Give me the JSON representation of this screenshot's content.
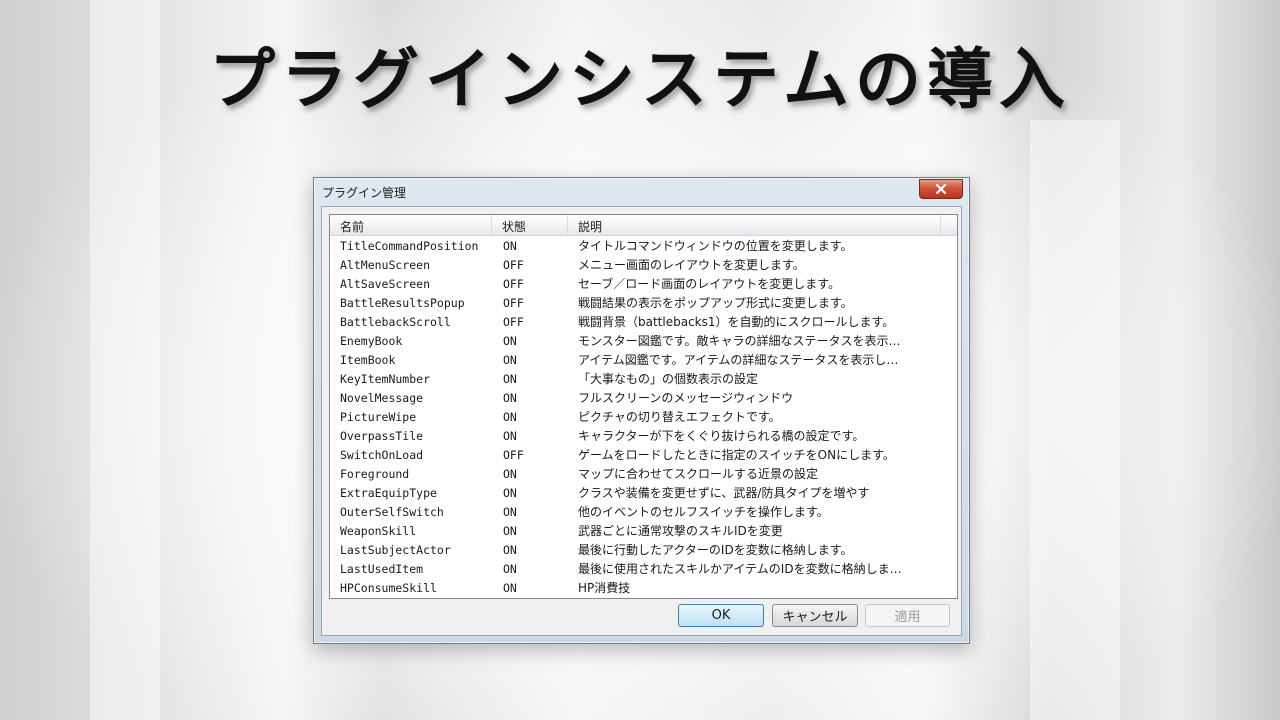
{
  "headline": "プラグインシステムの導入",
  "window": {
    "title": "プラグイン管理",
    "close_icon": "close-x-icon"
  },
  "list": {
    "columns": [
      "名前",
      "状態",
      "説明"
    ],
    "rows": [
      {
        "name": "TitleCommandPosition",
        "status": "ON",
        "desc": "タイトルコマンドウィンドウの位置を変更します。"
      },
      {
        "name": "AltMenuScreen",
        "status": "OFF",
        "desc": "メニュー画面のレイアウトを変更します。"
      },
      {
        "name": "AltSaveScreen",
        "status": "OFF",
        "desc": "セーブ／ロード画面のレイアウトを変更します。"
      },
      {
        "name": "BattleResultsPopup",
        "status": "OFF",
        "desc": "戦闘結果の表示をポップアップ形式に変更します。"
      },
      {
        "name": "BattlebackScroll",
        "status": "OFF",
        "desc": "戦闘背景（battlebacks1）を自動的にスクロールします。"
      },
      {
        "name": "EnemyBook",
        "status": "ON",
        "desc": "モンスター図鑑です。敵キャラの詳細なステータスを表示…"
      },
      {
        "name": "ItemBook",
        "status": "ON",
        "desc": "アイテム図鑑です。アイテムの詳細なステータスを表示し…"
      },
      {
        "name": "KeyItemNumber",
        "status": "ON",
        "desc": "「大事なもの」の個数表示の設定"
      },
      {
        "name": "NovelMessage",
        "status": "ON",
        "desc": "フルスクリーンのメッセージウィンドウ"
      },
      {
        "name": "PictureWipe",
        "status": "ON",
        "desc": "ピクチャの切り替えエフェクトです。"
      },
      {
        "name": "OverpassTile",
        "status": "ON",
        "desc": "キャラクターが下をくぐり抜けられる橋の設定です。"
      },
      {
        "name": "SwitchOnLoad",
        "status": "OFF",
        "desc": "ゲームをロードしたときに指定のスイッチをONにします。"
      },
      {
        "name": "Foreground",
        "status": "ON",
        "desc": "マップに合わせてスクロールする近景の設定"
      },
      {
        "name": "ExtraEquipType",
        "status": "ON",
        "desc": "クラスや装備を変更せずに、武器/防具タイプを増やす"
      },
      {
        "name": "OuterSelfSwitch",
        "status": "ON",
        "desc": "他のイベントのセルフスイッチを操作します。"
      },
      {
        "name": "WeaponSkill",
        "status": "ON",
        "desc": "武器ごとに通常攻撃のスキルIDを変更"
      },
      {
        "name": "LastSubjectActor",
        "status": "ON",
        "desc": "最後に行動したアクターのIDを変数に格納します。"
      },
      {
        "name": "LastUsedItem",
        "status": "ON",
        "desc": "最後に使用されたスキルかアイテムのIDを変数に格納しま…"
      },
      {
        "name": "HPConsumeSkill",
        "status": "ON",
        "desc": "HP消費技"
      }
    ]
  },
  "buttons": {
    "ok": "OK",
    "cancel": "キャンセル",
    "apply": "適用"
  }
}
